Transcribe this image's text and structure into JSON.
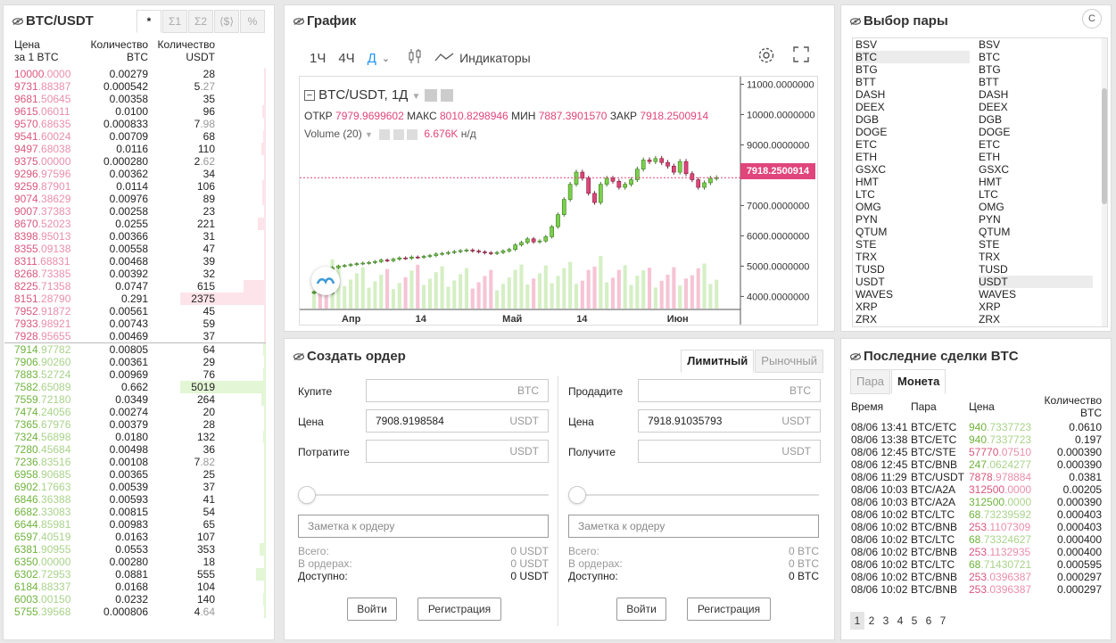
{
  "colors": {
    "ask": "#d9577f",
    "bid": "#6fb33c",
    "accent": "#2196f3",
    "close_line": "#e0457b"
  },
  "orderbook": {
    "title": "BTC/USDT",
    "tabs": [
      "*",
      "Σ1",
      "Σ2",
      "⟨$⟩",
      "%"
    ],
    "head": {
      "price": "Цена",
      "price2": "за 1 BTC",
      "amount": "Количество",
      "amount2": "BTC",
      "total": "Количество",
      "total2": "USDT"
    },
    "asks": [
      [
        "10000",
        ".0000",
        "0.00279",
        "28",
        "",
        0.02
      ],
      [
        "9731",
        ".88387",
        "0.000542",
        "5",
        ".27",
        0.005
      ],
      [
        "9681",
        ".50645",
        "0.00358",
        "35",
        "",
        0.015
      ],
      [
        "9615",
        ".06011",
        "0.0100",
        "96",
        "",
        0.04
      ],
      [
        "9570",
        ".68635",
        "0.000833",
        "7",
        ".98",
        0.005
      ],
      [
        "9541",
        ".60024",
        "0.00709",
        "68",
        "",
        0.03
      ],
      [
        "9497",
        ".68038",
        "0.0116",
        "110",
        "",
        0.05
      ],
      [
        "9375",
        ".00000",
        "0.000280",
        "2",
        ".62",
        0.002
      ],
      [
        "9296",
        ".97596",
        "0.00362",
        "34",
        "",
        0.015
      ],
      [
        "9259",
        ".87901",
        "0.0114",
        "106",
        "",
        0.045
      ],
      [
        "9074",
        ".38629",
        "0.00976",
        "89",
        "",
        0.04
      ],
      [
        "9007",
        ".37383",
        "0.00258",
        "23",
        "",
        0.01
      ],
      [
        "8670",
        ".52023",
        "0.0255",
        "221",
        "",
        0.09
      ],
      [
        "8398",
        ".95013",
        "0.00366",
        "31",
        "",
        0.015
      ],
      [
        "8355",
        ".09138",
        "0.00558",
        "47",
        "",
        0.02
      ],
      [
        "8311",
        ".68831",
        "0.00468",
        "39",
        "",
        0.015
      ],
      [
        "8268",
        ".73385",
        "0.00392",
        "32",
        "",
        0.015
      ],
      [
        "8225",
        ".71358",
        "0.0747",
        "615",
        "",
        0.26
      ],
      [
        "8151",
        ".28790",
        "0.291",
        "2375",
        "",
        1.0
      ],
      [
        "7952",
        ".91872",
        "0.00561",
        "45",
        "",
        0.02
      ],
      [
        "7933",
        ".98921",
        "0.00743",
        "59",
        "",
        0.025
      ],
      [
        "7928",
        ".95655",
        "0.00469",
        "37",
        "",
        0.015
      ]
    ],
    "bids": [
      [
        "7914",
        ".97782",
        "0.00805",
        "64",
        "",
        0.03
      ],
      [
        "7906",
        ".90260",
        "0.00361",
        "29",
        "",
        0.015
      ],
      [
        "7883",
        ".52724",
        "0.00969",
        "76",
        "",
        0.035
      ],
      [
        "7582",
        ".65089",
        "0.662",
        "5019",
        "",
        1.0
      ],
      [
        "7559",
        ".72180",
        "0.0349",
        "264",
        "",
        0.055
      ],
      [
        "7474",
        ".24056",
        "0.00274",
        "20",
        "",
        0.01
      ],
      [
        "7365",
        ".67976",
        "0.00379",
        "28",
        "",
        0.01
      ],
      [
        "7324",
        ".56898",
        "0.0180",
        "132",
        "",
        0.03
      ],
      [
        "7280",
        ".45684",
        "0.00498",
        "36",
        "",
        0.01
      ],
      [
        "7236",
        ".83516",
        "0.00108",
        "7",
        ".82",
        0.004
      ],
      [
        "6958",
        ".90685",
        "0.00365",
        "25",
        "",
        0.008
      ],
      [
        "6902",
        ".17663",
        "0.00539",
        "37",
        "",
        0.01
      ],
      [
        "6846",
        ".36388",
        "0.00593",
        "41",
        "",
        0.01
      ],
      [
        "6682",
        ".33083",
        "0.00815",
        "54",
        "",
        0.015
      ],
      [
        "6644",
        ".85981",
        "0.00983",
        "65",
        "",
        0.018
      ],
      [
        "6597",
        ".40519",
        "0.0163",
        "107",
        "",
        0.025
      ],
      [
        "6381",
        ".90955",
        "0.0553",
        "353",
        "",
        0.075
      ],
      [
        "6350",
        ".00000",
        "0.00280",
        "18",
        "",
        0.006
      ],
      [
        "6302",
        ".72953",
        "0.0881",
        "555",
        "",
        0.11
      ],
      [
        "6184",
        ".88337",
        "0.0168",
        "104",
        "",
        0.025
      ],
      [
        "6003",
        ".00150",
        "0.0232",
        "140",
        "",
        0.03
      ],
      [
        "5755",
        ".39568",
        "0.000806",
        "4",
        ".64",
        0.003
      ]
    ]
  },
  "chart": {
    "title": "График",
    "intervals": [
      "1Ч",
      "4Ч",
      "Д"
    ],
    "active_interval": "Д",
    "indicators_label": "Индикаторы",
    "symbol": "BTC/USDT, 1Д",
    "ohlc": {
      "o_label": "ОТКР",
      "o": "7979.9699602",
      "h_label": "МАКС",
      "h": "8010.8298946",
      "l_label": "МИН",
      "l": "7887.3901570",
      "c_label": "ЗАКР",
      "c": "7918.2500914"
    },
    "volume_label": "Volume (20)",
    "volume_value": "6.676K",
    "volume_na": "н/д",
    "last_price": "7918.2500914",
    "x_ticks": [
      "Апр",
      "14",
      "Май",
      "14",
      "Июн"
    ]
  },
  "chart_data": {
    "type": "candlestick",
    "y_ticks": [
      "11000.0000000",
      "10000.0000000",
      "9000.0000000",
      "8000.0000000",
      "7000.0000000",
      "6000.0000000",
      "5000.0000000",
      "4000.0000000"
    ],
    "ylim": [
      3600,
      11250
    ],
    "closes": [
      4150,
      4120,
      4100,
      4950,
      5000,
      5020,
      5050,
      5080,
      5100,
      5120,
      5150,
      5200,
      5180,
      5230,
      5270,
      5260,
      5300,
      5290,
      5320,
      5350,
      5400,
      5420,
      5450,
      5480,
      5510,
      5530,
      5500,
      5470,
      5440,
      5420,
      5450,
      5500,
      5550,
      5700,
      5780,
      5900,
      5800,
      5830,
      5970,
      6300,
      6700,
      7200,
      7700,
      8100,
      7900,
      7400,
      7100,
      7700,
      7900,
      7800,
      7600,
      7700,
      7850,
      8200,
      8500,
      8450,
      8550,
      8420,
      8300,
      8100,
      8450,
      8050,
      7850,
      7600,
      7750,
      7900,
      7918
    ]
  },
  "pairs": {
    "title": "Выбор пары",
    "left": [
      "BSV",
      "BTC",
      "BTG",
      "BTT",
      "DASH",
      "DEEX",
      "DGB",
      "DOGE",
      "ETC",
      "ETH",
      "GSXC",
      "HMT",
      "LTC",
      "OMG",
      "PYN",
      "QTUM",
      "STE",
      "TRX",
      "TUSD",
      "USDT",
      "WAVES",
      "XRP",
      "ZRX"
    ],
    "right": [
      "BSV",
      "BTC",
      "BTG",
      "BTT",
      "DASH",
      "DEEX",
      "DGB",
      "DOGE",
      "ETC",
      "ETH",
      "GSXC",
      "HMT",
      "LTC",
      "OMG",
      "PYN",
      "QTUM",
      "STE",
      "TRX",
      "TUSD",
      "USDT",
      "WAVES",
      "XRP",
      "ZRX"
    ],
    "selected_left": "BTC",
    "selected_right": "USDT",
    "refresh_glyph": "C"
  },
  "order": {
    "title": "Создать ордер",
    "tabs": [
      "Лимитный",
      "Рыночный"
    ],
    "buy": {
      "f1": "Купите",
      "f1_unit": "BTC",
      "f1_val": "",
      "f2": "Цена",
      "f2_unit": "USDT",
      "f2_val": "7908.9198584",
      "f3": "Потратите",
      "f3_unit": "USDT",
      "f3_val": "",
      "note": "Заметка к ордеру",
      "total_l": "Всего:",
      "total_v": "0 USDT",
      "inord_l": "В ордерах:",
      "inord_v": "0 USDT",
      "avail_l": "Доступно:",
      "avail_v": "0 USDT"
    },
    "sell": {
      "f1": "Продадите",
      "f1_unit": "BTC",
      "f1_val": "",
      "f2": "Цена",
      "f2_unit": "USDT",
      "f2_val": "7918.91035793",
      "f3": "Получите",
      "f3_unit": "USDT",
      "f3_val": "",
      "note": "Заметка к ордеру",
      "total_l": "Всего:",
      "total_v": "0 BTC",
      "inord_l": "В ордерах:",
      "inord_v": "0 BTC",
      "avail_l": "Доступно:",
      "avail_v": "0 BTC"
    },
    "login": "Войти",
    "register": "Регистрация"
  },
  "trades": {
    "title": "Последние сделки BTC",
    "tabs": [
      "Пара",
      "Монета"
    ],
    "head": {
      "time": "Время",
      "pair": "Пара",
      "price": "Цена",
      "qty": "Количество",
      "qty2": "BTC"
    },
    "rows": [
      [
        "08/06 13:41",
        "BTC/ETC",
        "940",
        ".7337723",
        "buy",
        "0.0610"
      ],
      [
        "08/06 13:38",
        "BTC/ETC",
        "940",
        ".7337723",
        "buy",
        "0.197"
      ],
      [
        "08/06 12:45",
        "BTC/STE",
        "57770",
        ".07510",
        "sell",
        "0.000390"
      ],
      [
        "08/06 12:45",
        "BTC/BNB",
        "247",
        ".0624277",
        "buy",
        "0.000390"
      ],
      [
        "08/06 11:29",
        "BTC/USDT",
        "7878",
        ".978884",
        "sell",
        "0.0381"
      ],
      [
        "08/06 10:03",
        "BTC/A2A",
        "312500",
        ".0000",
        "sell",
        "0.00205"
      ],
      [
        "08/06 10:03",
        "BTC/A2A",
        "312500",
        ".0000",
        "buy",
        "0.000390"
      ],
      [
        "08/06 10:02",
        "BTC/LTC",
        "68",
        ".73239592",
        "buy",
        "0.000403"
      ],
      [
        "08/06 10:02",
        "BTC/BNB",
        "253",
        ".1107309",
        "sell",
        "0.000403"
      ],
      [
        "08/06 10:02",
        "BTC/LTC",
        "68",
        ".73324627",
        "buy",
        "0.000400"
      ],
      [
        "08/06 10:02",
        "BTC/BNB",
        "253",
        ".1132935",
        "sell",
        "0.000400"
      ],
      [
        "08/06 10:02",
        "BTC/LTC",
        "68",
        ".71430721",
        "buy",
        "0.000595"
      ],
      [
        "08/06 10:02",
        "BTC/BNB",
        "253",
        ".0396387",
        "sell",
        "0.000297"
      ],
      [
        "08/06 10:02",
        "BTC/BNB",
        "253",
        ".0396387",
        "sell",
        "0.000297"
      ]
    ],
    "pages": [
      "1",
      "2",
      "3",
      "4",
      "5",
      "6",
      "7"
    ]
  }
}
